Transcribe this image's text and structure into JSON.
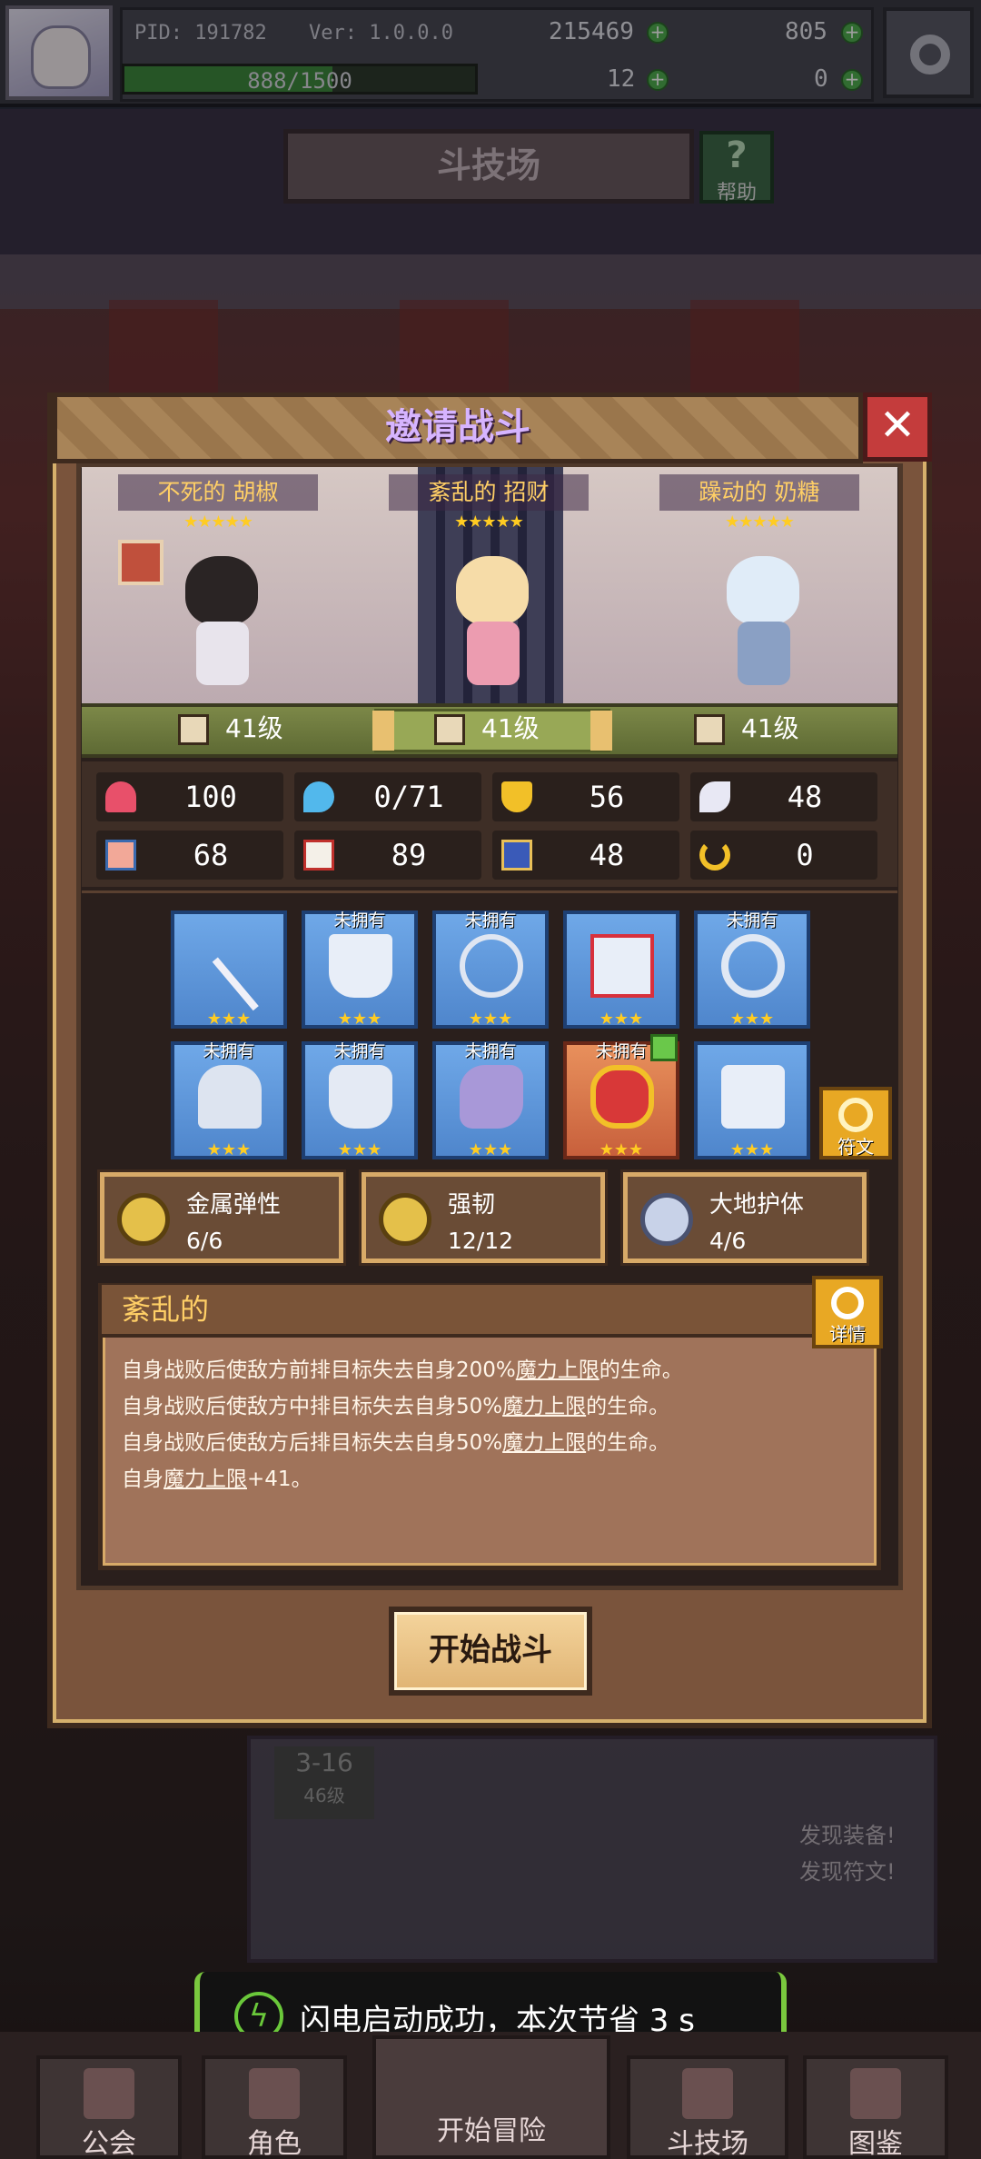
{
  "topbar": {
    "pid": "PID: 191782",
    "version": "Ver: 1.0.0.0",
    "gold": "215469",
    "gems": "805",
    "stamina": "888/1500",
    "stamina_ratio": 0.592,
    "clover": "12",
    "item": "0"
  },
  "arena": {
    "title": "斗技场",
    "help_label": "帮助"
  },
  "modal": {
    "title": "邀请战斗",
    "close": "✕",
    "team": [
      {
        "name": "不死的 胡椒",
        "stars": "★★★★★",
        "level": "41级"
      },
      {
        "name": "紊乱的 招财",
        "stars": "★★★★★",
        "level": "41级"
      },
      {
        "name": "躁动的 奶糖",
        "stars": "★★★★★",
        "level": "41级"
      }
    ],
    "stats": [
      {
        "icon": "heart-icon",
        "value": "100"
      },
      {
        "icon": "mana-drop-icon",
        "value": "0/71"
      },
      {
        "icon": "shield-icon",
        "value": "56"
      },
      {
        "icon": "wing-icon",
        "value": "48"
      },
      {
        "icon": "fist-icon",
        "value": "68"
      },
      {
        "icon": "book-icon",
        "value": "89"
      },
      {
        "icon": "boots-icon",
        "value": "48"
      },
      {
        "icon": "horseshoe-icon",
        "value": "0"
      }
    ],
    "equipment": [
      {
        "icon": "staff-icon",
        "stars": "★★★",
        "not_owned": ""
      },
      {
        "icon": "shield-equip-icon",
        "stars": "★★★",
        "not_owned": "未拥有"
      },
      {
        "icon": "necklace-icon",
        "stars": "★★★",
        "not_owned": "未拥有"
      },
      {
        "icon": "heart-armor-icon",
        "stars": "★★★",
        "not_owned": ""
      },
      {
        "icon": "ring-icon",
        "stars": "★★★",
        "not_owned": "未拥有"
      },
      {
        "icon": "helmet-icon",
        "stars": "★★★",
        "not_owned": "未拥有"
      },
      {
        "icon": "breastplate-icon",
        "stars": "★★★",
        "not_owned": "未拥有"
      },
      {
        "icon": "gauntlet-icon",
        "stars": "★★★",
        "not_owned": "未拥有"
      },
      {
        "icon": "jewel-ring-icon",
        "stars": "★★★",
        "not_owned": "未拥有"
      },
      {
        "icon": "greaves-icon",
        "stars": "★★★",
        "not_owned": ""
      }
    ],
    "rune_label": "符文",
    "sets": [
      {
        "name": "金属弹性",
        "count": "6/6"
      },
      {
        "name": "强韧",
        "count": "12/12"
      },
      {
        "name": "大地护体",
        "count": "4/6"
      }
    ],
    "trait": {
      "title": "紊乱的",
      "detail_label": "详情",
      "line1_a": "自身战败后使敌方前排目标失去自身200%",
      "line1_u": "魔力上限",
      "line1_b": "的生命。",
      "line2_a": "自身战败后使敌方中排目标失去自身50%",
      "line2_u": "魔力上限",
      "line2_b": "的生命。",
      "line3_a": "自身战败后使敌方后排目标失去自身50%",
      "line3_u": "魔力上限",
      "line3_b": "的生命。",
      "line4_a": "自身",
      "line4_u": "魔力上限",
      "line4_b": "+41。"
    },
    "start_label": "开始战斗"
  },
  "background": {
    "stage": "3-16",
    "stage_level": "46级",
    "discover1": "发现装备!",
    "discover2": "发现符文!"
  },
  "toast": {
    "text": "闪电启动成功，本次节省 3 s"
  },
  "nav": {
    "guild": "公会",
    "character": "角色",
    "adventure": "开始冒险",
    "arena": "斗技场",
    "codex": "图鉴"
  }
}
